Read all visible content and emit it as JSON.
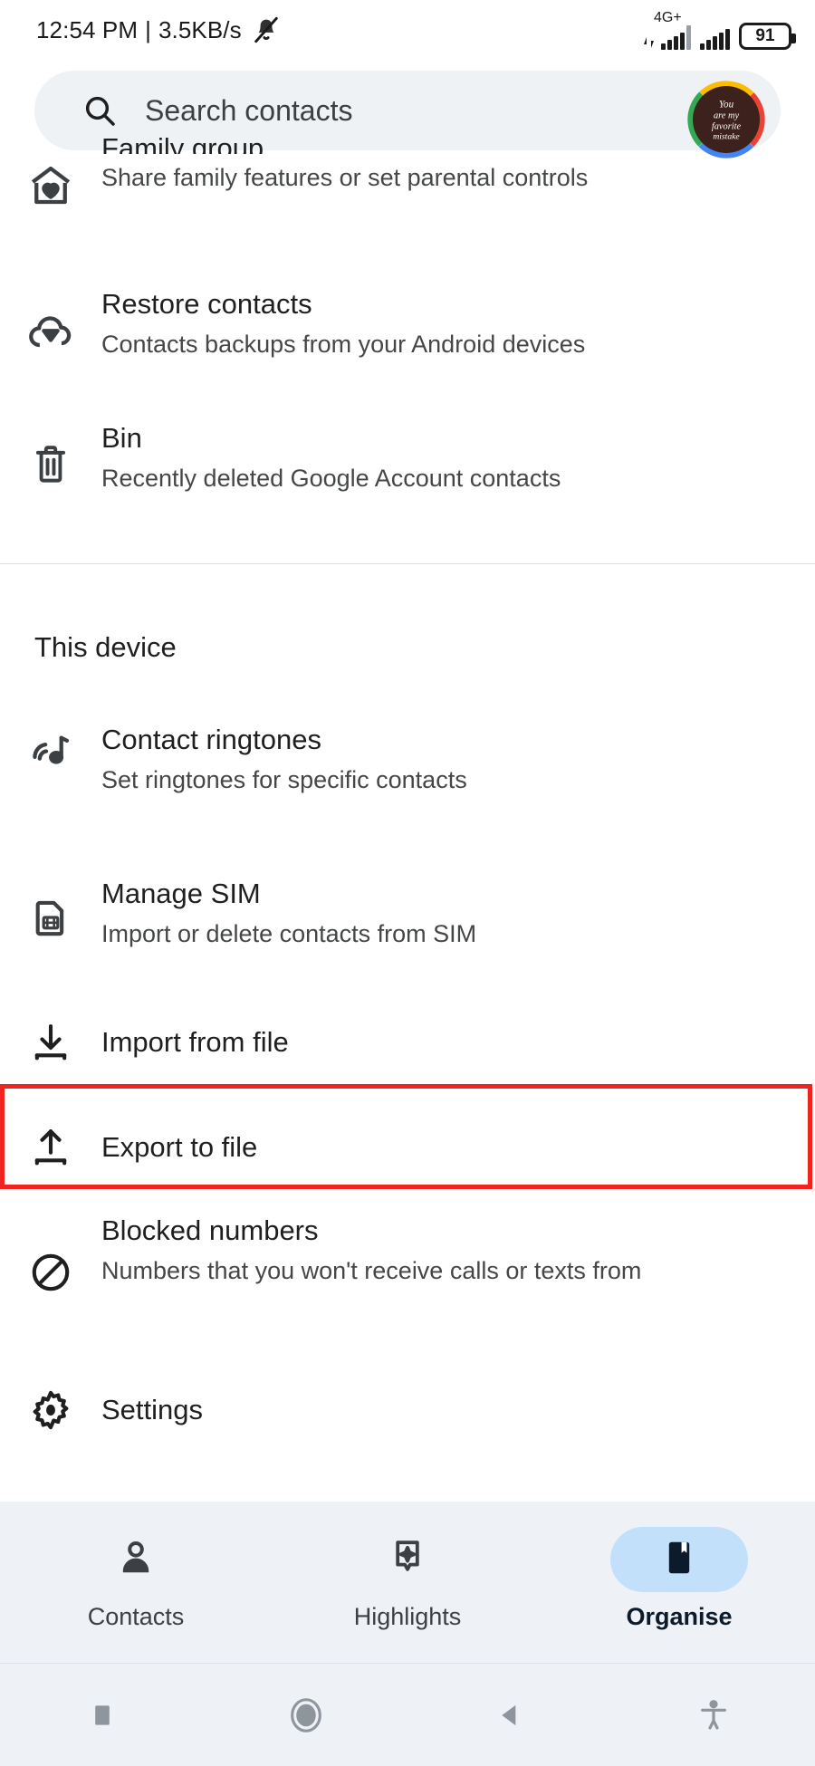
{
  "status_bar": {
    "time": "12:54 PM",
    "separator": "|",
    "network_speed": "3.5KB/s",
    "mute_icon": "bell-muted-icon",
    "network_type": "4G+",
    "battery_percent": "91"
  },
  "search": {
    "placeholder": "Search contacts",
    "icon": "search-icon",
    "avatar": {
      "name": "account-avatar",
      "text_line1": "You",
      "text_line2": "are my",
      "text_line3": "favorite",
      "text_line4": "mistake",
      "ring_colors": [
        "#ea4335",
        "#4285f4",
        "#34a853",
        "#fbbc04"
      ],
      "background": "#3c211c"
    }
  },
  "google_account_section": {
    "items": [
      {
        "icon": "home-heart-icon",
        "title": "Family group",
        "subtitle": "Share family features or set parental controls",
        "clipped": true
      },
      {
        "icon": "cloud-download-icon",
        "title": "Restore contacts",
        "subtitle": "Contacts backups from your Android devices"
      },
      {
        "icon": "trash-bin-icon",
        "title": "Bin",
        "subtitle": "Recently deleted Google Account contacts"
      }
    ]
  },
  "this_device_section": {
    "heading": "This device",
    "items": [
      {
        "icon": "ringtone-icon",
        "title": "Contact ringtones",
        "subtitle": "Set ringtones for specific contacts"
      },
      {
        "icon": "sim-card-icon",
        "title": "Manage SIM",
        "subtitle": "Import or delete contacts from SIM"
      },
      {
        "icon": "import-download-icon",
        "title": "Import from file",
        "subtitle": ""
      },
      {
        "icon": "export-upload-icon",
        "title": "Export to file",
        "subtitle": "",
        "highlighted": true
      },
      {
        "icon": "blocked-circle-icon",
        "title": "Blocked numbers",
        "subtitle": "Numbers that you won't receive calls or texts from"
      },
      {
        "icon": "gear-icon",
        "title": "Settings",
        "subtitle": ""
      }
    ]
  },
  "highlight": {
    "target": "Export to file",
    "color": "#f0231e"
  },
  "bottom_nav": {
    "items": [
      {
        "icon": "person-icon",
        "label": "Contacts",
        "active": false
      },
      {
        "icon": "highlights-sparkle-icon",
        "label": "Highlights",
        "active": false
      },
      {
        "icon": "bookmark-organise-icon",
        "label": "Organise",
        "active": true
      }
    ],
    "active_pill_color": "#c3e0fb"
  },
  "system_nav": {
    "buttons": [
      {
        "icon": "recents-square-icon"
      },
      {
        "icon": "home-circle-icon"
      },
      {
        "icon": "back-triangle-icon"
      },
      {
        "icon": "accessibility-icon"
      }
    ]
  }
}
